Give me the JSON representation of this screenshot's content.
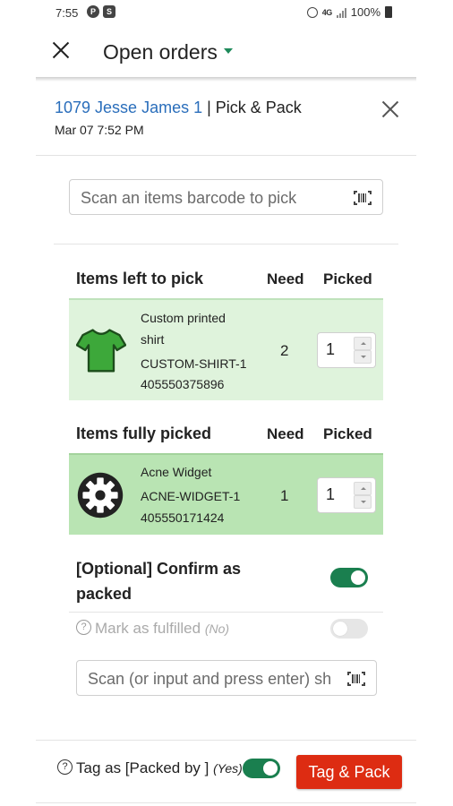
{
  "status_bar": {
    "time": "7:55",
    "network": "4G",
    "battery": "100%"
  },
  "header": {
    "title": "Open orders"
  },
  "order": {
    "link_text": "1079 Jesse James 1",
    "separator_text": " | Pick & Pack",
    "date": "Mar 07 7:52 PM"
  },
  "scan": {
    "placeholder": "Scan an items barcode to pick"
  },
  "table_headers": {
    "need": "Need",
    "picked": "Picked"
  },
  "pending_section": {
    "title": "Items left to pick",
    "items": [
      {
        "name_line1": "Custom printed",
        "name_line2": "shirt",
        "sku": "CUSTOM-SHIRT-1",
        "barcode": "405550375896",
        "need": "2",
        "picked": "1"
      }
    ]
  },
  "done_section": {
    "title": "Items fully picked",
    "items": [
      {
        "name": "Acne Widget",
        "sku": "ACNE-WIDGET-1",
        "barcode": "405550171424",
        "need": "1",
        "picked": "1"
      }
    ]
  },
  "confirm": {
    "label": "[Optional] Confirm as packed",
    "enabled": true
  },
  "fulfilled": {
    "label": "Mark as fulfilled",
    "status": "(No)",
    "enabled": false
  },
  "scan_tracking": {
    "placeholder": "Scan (or input and press enter) sh"
  },
  "footer": {
    "tag_label": "Tag as [Packed by ]",
    "tag_status": "(Yes)",
    "tag_enabled": true,
    "button_label": "Tag & Pack"
  },
  "colors": {
    "accent_green": "#1a7f4f",
    "link_blue": "#2a6ebb",
    "action_red": "#dd2c12",
    "pending_row": "#dff3dc",
    "done_row": "#b9e4b3"
  }
}
